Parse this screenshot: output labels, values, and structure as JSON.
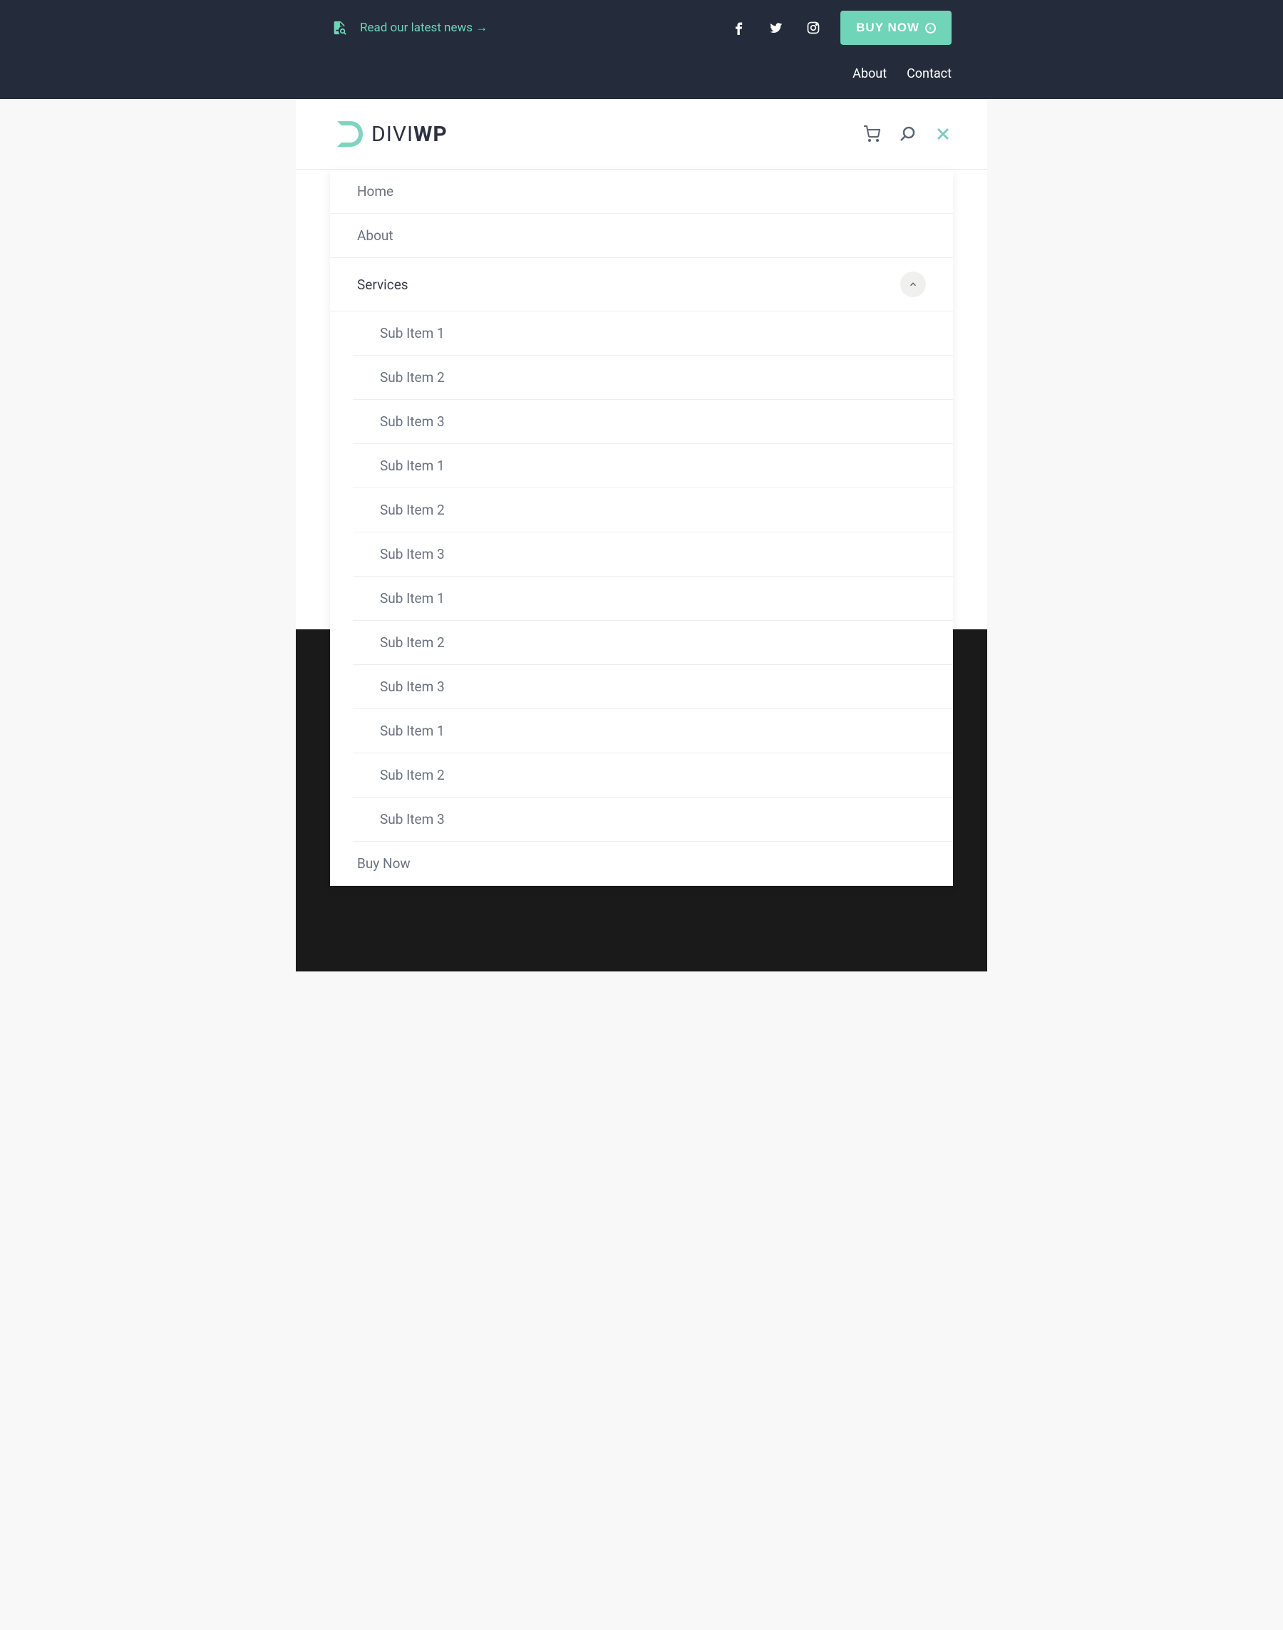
{
  "topbar": {
    "news_text": "Read our latest news →",
    "buy_now": "BUY NOW",
    "links": {
      "about": "About",
      "contact": "Contact"
    }
  },
  "logo": {
    "part1": "DIVI",
    "part2": "WP"
  },
  "menu": {
    "home": "Home",
    "about": "About",
    "services": "Services",
    "sub_items": [
      "Sub Item 1",
      "Sub Item 2",
      "Sub Item 3",
      "Sub Item 1",
      "Sub Item 2",
      "Sub Item 3",
      "Sub Item 1",
      "Sub Item 2",
      "Sub Item 3",
      "Sub Item 1",
      "Sub Item 2",
      "Sub Item 3"
    ],
    "buy_now": "Buy Now"
  },
  "colors": {
    "accent": "#6fd4b8",
    "dark": "#242c3b",
    "text": "#6a7380"
  }
}
